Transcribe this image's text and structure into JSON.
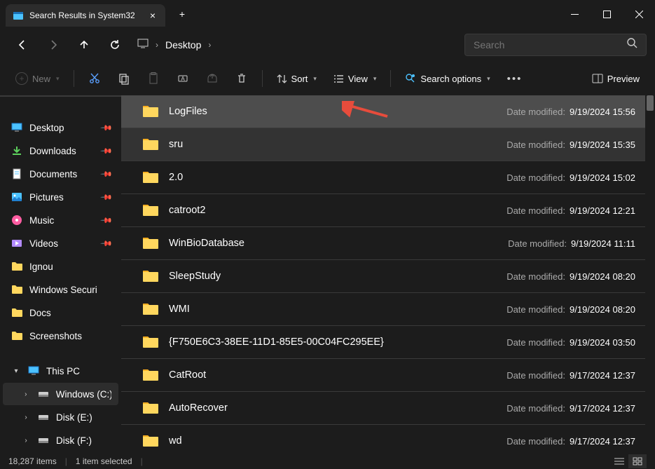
{
  "window": {
    "title": "Search Results in System32"
  },
  "breadcrumb": {
    "location": "Desktop"
  },
  "search": {
    "placeholder": "Search"
  },
  "toolbar": {
    "new": "New",
    "sort": "Sort",
    "view": "View",
    "search_options": "Search options",
    "preview": "Preview"
  },
  "sidebar": {
    "quick": [
      {
        "label": "Desktop",
        "icon": "desktop",
        "pinned": true
      },
      {
        "label": "Downloads",
        "icon": "downloads",
        "pinned": true
      },
      {
        "label": "Documents",
        "icon": "documents",
        "pinned": true
      },
      {
        "label": "Pictures",
        "icon": "pictures",
        "pinned": true
      },
      {
        "label": "Music",
        "icon": "music",
        "pinned": true
      },
      {
        "label": "Videos",
        "icon": "videos",
        "pinned": true
      },
      {
        "label": "Ignou",
        "icon": "folder",
        "pinned": false
      },
      {
        "label": "Windows Securi",
        "icon": "folder",
        "pinned": false
      },
      {
        "label": "Docs",
        "icon": "folder",
        "pinned": false
      },
      {
        "label": "Screenshots",
        "icon": "folder",
        "pinned": false
      }
    ],
    "thispc": {
      "label": "This PC",
      "children": [
        {
          "label": "Windows (C:)",
          "active": true
        },
        {
          "label": "Disk (E:)",
          "active": false
        },
        {
          "label": "Disk (F:)",
          "active": false
        }
      ]
    }
  },
  "files": [
    {
      "name": "LogFiles",
      "meta_label": "Date modified:",
      "meta_val": "9/19/2024 15:56",
      "selected": true,
      "arrow": true
    },
    {
      "name": "sru",
      "meta_label": "Date modified:",
      "meta_val": "9/19/2024 15:35",
      "hover": true
    },
    {
      "name": "2.0",
      "meta_label": "Date modified:",
      "meta_val": "9/19/2024 15:02"
    },
    {
      "name": "catroot2",
      "meta_label": "Date modified:",
      "meta_val": "9/19/2024 12:21"
    },
    {
      "name": "WinBioDatabase",
      "meta_label": "Date modified:",
      "meta_val": "9/19/2024 11:11"
    },
    {
      "name": "SleepStudy",
      "meta_label": "Date modified:",
      "meta_val": "9/19/2024 08:20"
    },
    {
      "name": "WMI",
      "meta_label": "Date modified:",
      "meta_val": "9/19/2024 08:20"
    },
    {
      "name": "{F750E6C3-38EE-11D1-85E5-00C04FC295EE}",
      "meta_label": "Date modified:",
      "meta_val": "9/19/2024 03:50"
    },
    {
      "name": "CatRoot",
      "meta_label": "Date modified:",
      "meta_val": "9/17/2024 12:37"
    },
    {
      "name": "AutoRecover",
      "meta_label": "Date modified:",
      "meta_val": "9/17/2024 12:37"
    },
    {
      "name": "wd",
      "meta_label": "Date modified:",
      "meta_val": "9/17/2024 12:37"
    }
  ],
  "status": {
    "count": "18,287 items",
    "selection": "1 item selected"
  }
}
